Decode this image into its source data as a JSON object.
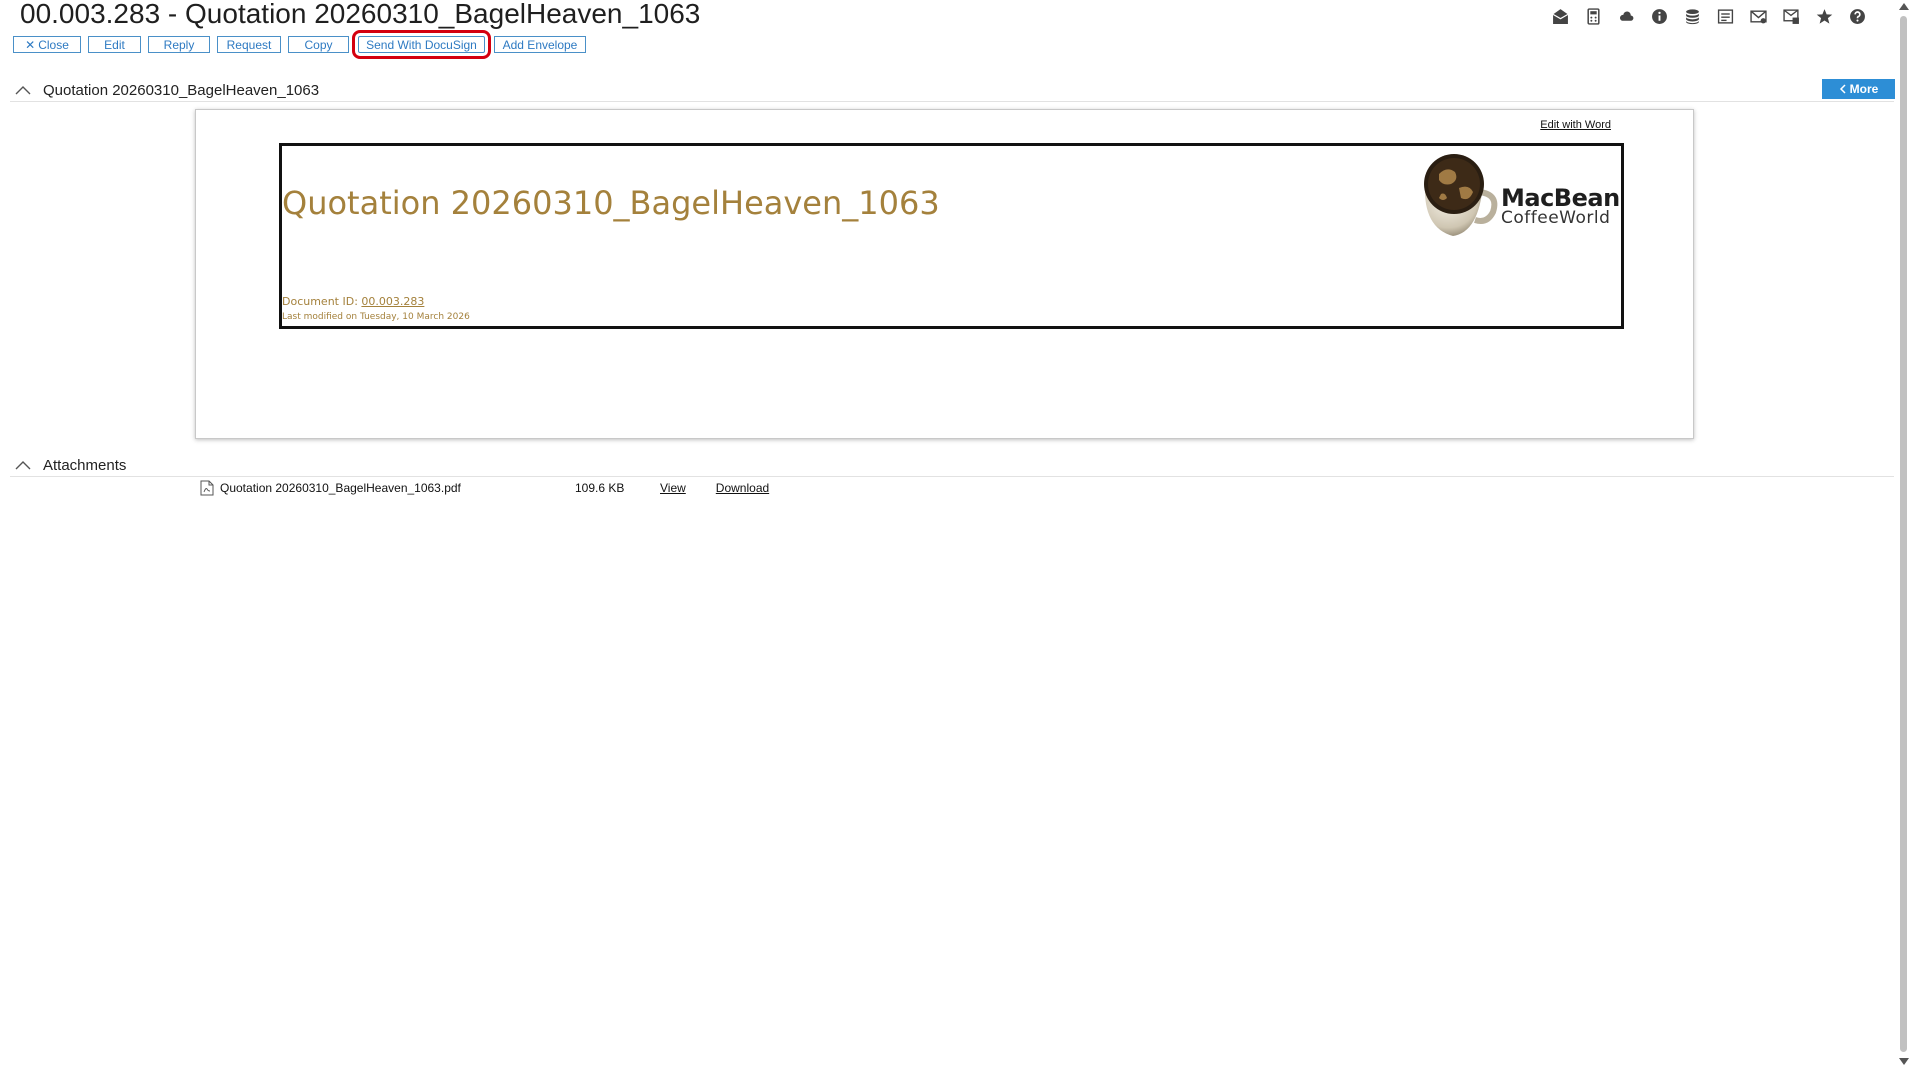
{
  "header": {
    "title": "00.003.283 - Quotation 20260310_BagelHeaven_1063"
  },
  "toolbar_icons": [
    {
      "name": "mail-open-icon"
    },
    {
      "name": "calculator-icon"
    },
    {
      "name": "cloud-icon"
    },
    {
      "name": "info-icon"
    },
    {
      "name": "database-icon"
    },
    {
      "name": "document-list-icon"
    },
    {
      "name": "mail-check-icon"
    },
    {
      "name": "mail-settings-icon"
    },
    {
      "name": "star-icon"
    },
    {
      "name": "help-icon"
    }
  ],
  "actions": {
    "close": "Close",
    "edit": "Edit",
    "reply": "Reply",
    "request": "Request",
    "copy": "Copy",
    "docusign": "Send With DocuSign",
    "add_envelope": "Add Envelope"
  },
  "section": {
    "title": "Quotation 20260310_BagelHeaven_1063",
    "more": "More"
  },
  "document": {
    "edit_with_word": "Edit with Word",
    "heading": "Quotation 20260310_BagelHeaven_1063",
    "id_label": "Document ID:",
    "id_value": "00.003.283",
    "last_modified": "Last modified on Tuesday, 10 March 2026",
    "logo_line1": "MacBean",
    "logo_line2": "CoffeeWorld"
  },
  "attachments": {
    "title": "Attachments",
    "items": [
      {
        "file_name": "Quotation 20260310_BagelHeaven_1063.pdf",
        "size": "109.6 KB",
        "view": "View",
        "download": "Download"
      }
    ]
  },
  "colors": {
    "accent_blue": "#2d8ed6",
    "doc_gold": "#a4813c",
    "highlight_red": "#d4000f"
  }
}
